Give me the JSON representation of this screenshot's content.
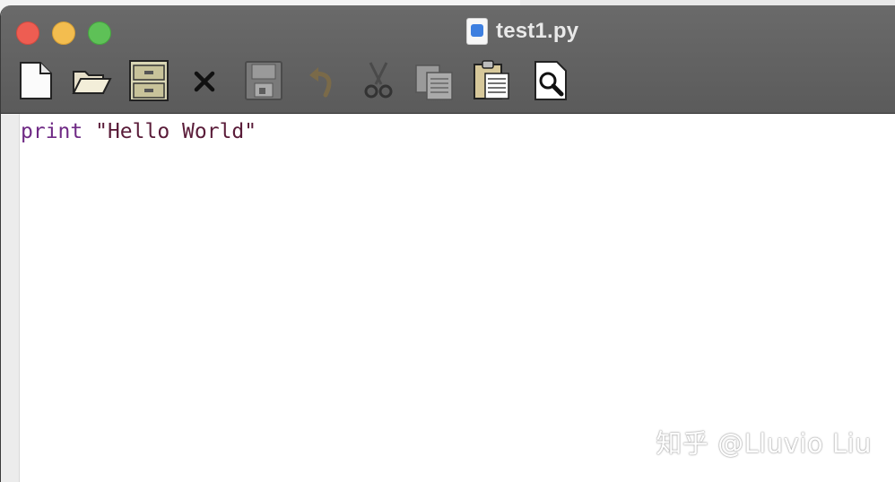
{
  "window": {
    "title": "test1.py"
  },
  "toolbar": {
    "buttons": [
      {
        "name": "new-file-icon"
      },
      {
        "name": "open-folder-icon"
      },
      {
        "name": "file-cabinet-icon"
      },
      {
        "name": "close-icon"
      },
      {
        "name": "save-disk-icon"
      },
      {
        "name": "undo-icon"
      },
      {
        "name": "cut-scissors-icon"
      },
      {
        "name": "copy-icon"
      },
      {
        "name": "paste-icon"
      },
      {
        "name": "find-icon"
      }
    ]
  },
  "editor": {
    "keyword": "print",
    "string": "\"Hello World\""
  },
  "watermark": "知乎 @Lluvio Liu",
  "colors": {
    "chrome": "#5f5f5f",
    "title_text": "#e9e9e9",
    "code_keyword": "#6f2a85",
    "code_string": "#5a1c39"
  }
}
